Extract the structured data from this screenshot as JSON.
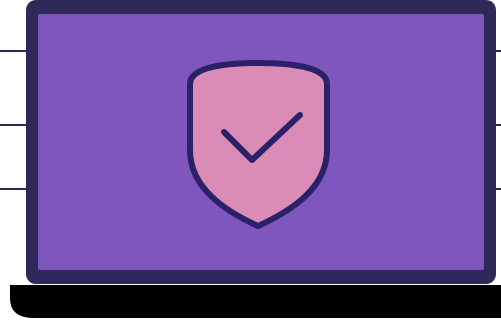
{
  "illustration": {
    "subject": "laptop-with-security-shield",
    "icons": [
      "laptop-icon",
      "shield-icon",
      "checkmark-icon"
    ],
    "colors": {
      "background": "#ffffff",
      "frame": "#2d2a5a",
      "screen": "#7f56bd",
      "shield_fill": "#da8bb6",
      "shield_outline": "#2a2168",
      "check_stroke": "#2a2168",
      "base": "#000000",
      "side_lines": "#2d2a5a"
    }
  }
}
